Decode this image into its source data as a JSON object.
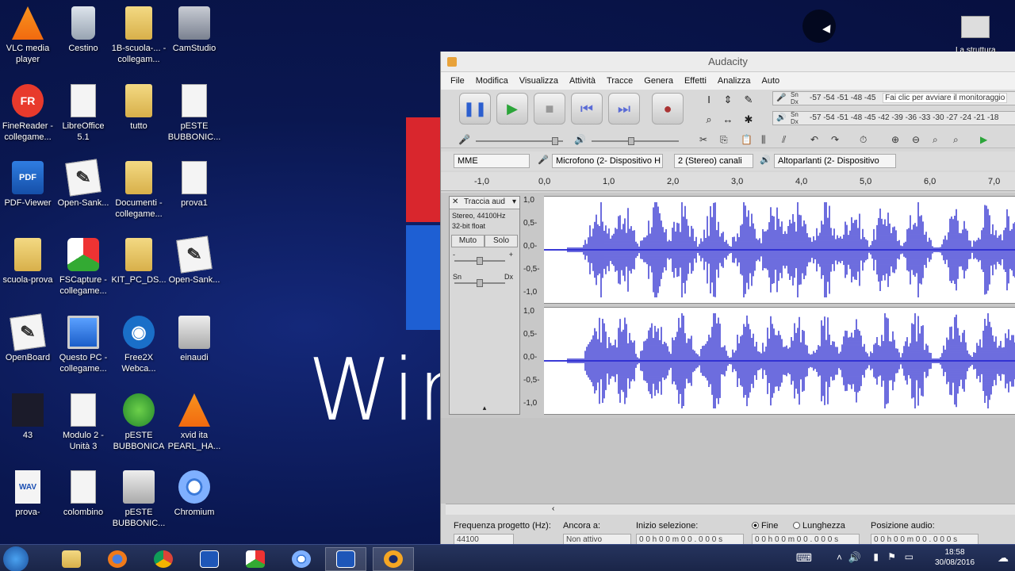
{
  "desktop": {
    "background_text": "Wir",
    "icons": [
      {
        "label": "VLC media player",
        "icon": "vlc-icon",
        "style": "vlc"
      },
      {
        "label": "Cestino",
        "icon": "recycle-bin-icon",
        "style": "bin"
      },
      {
        "label": "1B-scuola-... - collegam...",
        "icon": "folder-icon",
        "style": "folder"
      },
      {
        "label": "CamStudio",
        "icon": "camstudio-icon",
        "style": "cam"
      },
      {
        "label": "FineReader - collegame...",
        "icon": "finereader-icon",
        "style": "fine",
        "glyph": "FR"
      },
      {
        "label": "LibreOffice 5.1",
        "icon": "document-icon",
        "style": "doc"
      },
      {
        "label": "tutto",
        "icon": "folder-icon",
        "style": "folder"
      },
      {
        "label": "pESTE BUBBONIC...",
        "icon": "document-icon",
        "style": "doc"
      },
      {
        "label": "PDF-Viewer",
        "icon": "pdf-viewer-icon",
        "style": "pdf",
        "glyph": "PDF"
      },
      {
        "label": "Open-Sank...",
        "icon": "pen-icon",
        "style": "pen",
        "glyph": "✎"
      },
      {
        "label": "Documenti - collegame...",
        "icon": "folder-icon",
        "style": "folder"
      },
      {
        "label": "prova1",
        "icon": "document-icon",
        "style": "doc"
      },
      {
        "label": "scuola-prova",
        "icon": "folder-icon",
        "style": "folder"
      },
      {
        "label": "FSCapture - collegame...",
        "icon": "fscapture-icon",
        "style": "fs"
      },
      {
        "label": "KIT_PC_DS...",
        "icon": "folder-icon",
        "style": "folder"
      },
      {
        "label": "Open-Sank...",
        "icon": "pen-icon",
        "style": "pen",
        "glyph": "✎"
      },
      {
        "label": "OpenBoard",
        "icon": "pen-icon",
        "style": "pen",
        "glyph": "✎"
      },
      {
        "label": "Questo PC - collegame...",
        "icon": "computer-icon",
        "style": "pc"
      },
      {
        "label": "Free2X Webca...",
        "icon": "webcam-icon",
        "style": "f2x",
        "glyph": "◉"
      },
      {
        "label": "einaudi",
        "icon": "image-icon",
        "style": "grey"
      },
      {
        "label": "43",
        "icon": "video-icon",
        "style": "dark"
      },
      {
        "label": "Modulo 2 - Unità 3",
        "icon": "document-icon",
        "style": "doc"
      },
      {
        "label": "pESTE BUBBONICA",
        "icon": "green-app-icon",
        "style": "green"
      },
      {
        "label": "xvid ita PEARL_HA...",
        "icon": "vlc-icon",
        "style": "vlc"
      },
      {
        "label": "prova-",
        "icon": "wav-file-icon",
        "style": "wav",
        "glyph": "WAV"
      },
      {
        "label": "colombino",
        "icon": "document-icon",
        "style": "doc"
      },
      {
        "label": "pESTE BUBBONIC...",
        "icon": "image-icon",
        "style": "grey"
      },
      {
        "label": "Chromium",
        "icon": "chromium-icon",
        "style": "chromium"
      }
    ],
    "top_right_icon": {
      "label": "La struttura"
    }
  },
  "audacity": {
    "title": "Audacity",
    "menu": [
      "File",
      "Modifica",
      "Visualizza",
      "Attività",
      "Tracce",
      "Genera",
      "Effetti",
      "Analizza",
      "Auto"
    ],
    "meters": {
      "record_scale": "-57 -54 -51 -48 -45",
      "record_hint": "Fai clic per avviare il monitoraggio",
      "play_scale": "-57 -54 -51 -48 -45 -42 -39 -36 -33 -30 -27 -24 -21 -18",
      "channel_labels": "Sn\nDx"
    },
    "devices": {
      "host": "MME",
      "mic": "Microfono (2- Dispositivo H",
      "channels": "2 (Stereo) canali",
      "speakers": "Altoparlanti (2- Dispositivo"
    },
    "ruler_ticks": [
      "-1,0",
      "0,0",
      "1,0",
      "2,0",
      "3,0",
      "4,0",
      "5,0",
      "6,0",
      "7,0"
    ],
    "track": {
      "name": "Traccia aud",
      "info1": "Stereo, 44100Hz",
      "info2": "32-bit float",
      "mute": "Muto",
      "solo": "Solo",
      "gain_minus": "-",
      "gain_plus": "+",
      "pan_left": "Sn",
      "pan_right": "Dx",
      "scale": [
        "1,0",
        "0,5-",
        "0,0-",
        "-0,5-",
        "-1,0"
      ]
    },
    "status": {
      "rate_label": "Frequenza progetto (Hz):",
      "rate_value": "44100",
      "snap_label": "Ancora a:",
      "snap_value": "Non attivo",
      "sel_label": "Inizio selezione:",
      "end_label": "Fine",
      "length_label": "Lunghezza",
      "pos_label": "Posizione audio:",
      "time_value": "0 0 h 0 0 m 0 0 . 0 0 0 s"
    }
  },
  "taskbar": {
    "clock_time": "18:58",
    "clock_date": "30/08/2016"
  }
}
